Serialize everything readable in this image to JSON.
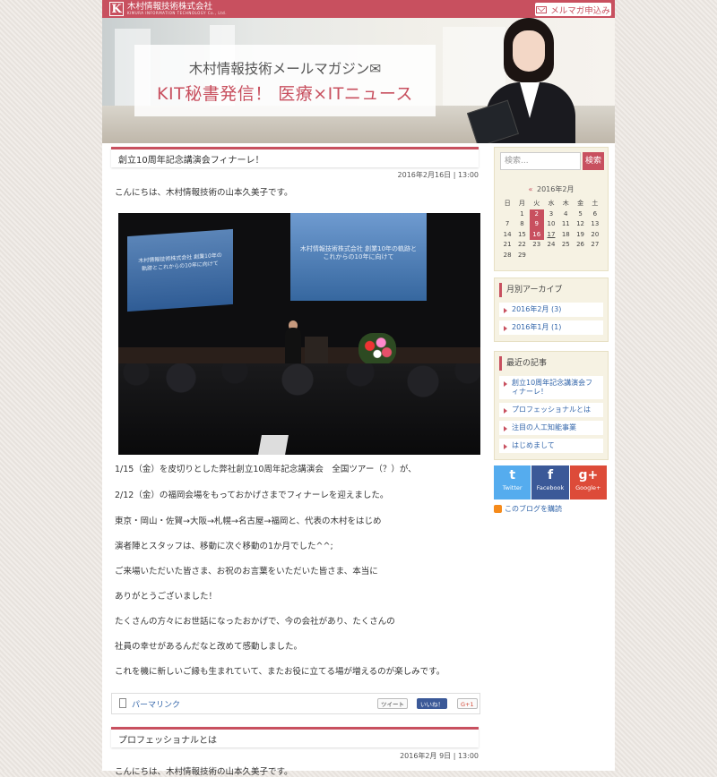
{
  "header": {
    "logo_letter": "K",
    "logo_jp": "木村情報技術株式会社",
    "logo_en": "KIMURA INFORMATION TECHNOLOGY Co., Ltd.",
    "mail_button": "メルマガ申込み"
  },
  "hero": {
    "line1": "木村情報技術メールマガジン✉",
    "line2": "KIT秘書発信！ 医療×ITニュース"
  },
  "posts": [
    {
      "title": "創立10周年記念講演会フィナーレ！",
      "date": "2016年2月16日 | 13:00",
      "greeting": "こんにちは、木村情報技術の山本久美子です。",
      "photo": {
        "screen_left": "木村情報技術株式会社 創業10年の軌跡とこれからの10年に向けて",
        "screen_right": "木村情報技術株式会社 創業10年の軌跡と これからの10年に向けて"
      },
      "paragraphs": [
        "1/15（金）を皮切りとした弊社創立10周年記念講演会　全国ツアー（？）が、",
        "2/12（金）の福岡会場をもっておかげさまでフィナーレを迎えました。",
        "東京・岡山・佐賀→大阪→札幌→名古屋→福岡と、代表の木村をはじめ",
        "演者陣とスタッフは、移動に次ぐ移動の1か月でした^^;",
        "ご来場いただいた皆さま、お祝のお言葉をいただいた皆さま、本当に",
        "ありがとうございました！",
        "たくさんの方々にお世話になったおかげで、今の会社があり、たくさんの",
        "社員の幸せがあるんだなと改めて感動しました。",
        "これを機に新しいご縁も生まれていて、またお役に立てる場が増えるのが楽しみです。"
      ],
      "permalink": "パーマリンク",
      "tweet": "ツイート",
      "like": "いいね！",
      "gplus": "G+1"
    },
    {
      "title": "プロフェッショナルとは",
      "date": "2016年2月 9日 | 13:00",
      "greeting": "こんにちは、木村情報技術の山本久美子です。"
    }
  ],
  "sidebar": {
    "search_placeholder": "検索...",
    "search_button": "検索",
    "calendar": {
      "title": "2016年2月",
      "weekdays": [
        "日",
        "月",
        "火",
        "水",
        "木",
        "金",
        "土"
      ],
      "days": [
        "",
        "1",
        "2",
        "3",
        "4",
        "5",
        "6",
        "7",
        "8",
        "9",
        "10",
        "11",
        "12",
        "13",
        "14",
        "15",
        "16",
        "17",
        "18",
        "19",
        "20",
        "21",
        "22",
        "23",
        "24",
        "25",
        "26",
        "27",
        "28",
        "29",
        "",
        "",
        "",
        "",
        "",
        ""
      ],
      "highlighted": [
        "2",
        "9",
        "16"
      ],
      "underlined": [
        "17"
      ]
    },
    "archive": {
      "title": "月別アーカイブ",
      "items": [
        "2016年2月 (3)",
        "2016年1月 (1)"
      ]
    },
    "recent": {
      "title": "最近の記事",
      "items": [
        "創立10周年記念講演会フィナーレ！",
        "プロフェッショナルとは",
        "注目の人工知能事業",
        "はじめまして"
      ]
    },
    "social": [
      {
        "glyph": "t",
        "label": "Twitter",
        "color": "#55acee"
      },
      {
        "glyph": "f",
        "label": "Facebook",
        "color": "#3b5998"
      },
      {
        "glyph": "g+",
        "label": "Google+",
        "color": "#dd4b39"
      }
    ],
    "rss": "このブログを購読"
  },
  "colors": {
    "accent": "#c8505f",
    "link": "#3366aa",
    "sidebar_bg": "#f6f2e3"
  }
}
